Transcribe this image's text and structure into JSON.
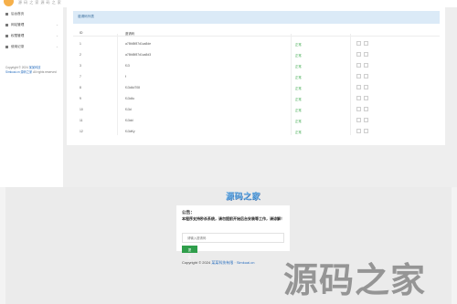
{
  "header": {
    "site_name": "源 码 之 家 源 码 之 家"
  },
  "sidebar": {
    "items": [
      {
        "label": "后台首页",
        "icon": "home-icon"
      },
      {
        "label": "网站管理",
        "icon": "gear-icon"
      },
      {
        "label": "权限管理",
        "icon": "key-icon"
      },
      {
        "label": "使用记录",
        "icon": "list-icon"
      }
    ],
    "footer_text": "Copyright © 2024",
    "footer_link1": "某某科技",
    "footer_link2": "Simkuai.cn 源码之家",
    "footer_rights": "All rights reserved"
  },
  "table": {
    "header_label": "邀请码列表",
    "columns": [
      "ID",
      "邀请码",
      "",
      ""
    ],
    "status_label": "正常",
    "rows": [
      {
        "id": "1",
        "code": "a78fd5f87d1ca8de"
      },
      {
        "id": "2",
        "code": "a78fd5f87d1ca8d3"
      },
      {
        "id": "3",
        "code": "f13"
      },
      {
        "id": "7",
        "code": "f"
      },
      {
        "id": "8",
        "code": "f13d4d708"
      },
      {
        "id": "9",
        "code": "f13d4c"
      },
      {
        "id": "10",
        "code": "f13d"
      },
      {
        "id": "11",
        "code": "f13dd"
      },
      {
        "id": "12",
        "code": "f13dKy"
      }
    ]
  },
  "login": {
    "brand": "源码之家",
    "title": "公告：",
    "message": "本程序支持秒杀系统，请勿提前开始后台安装等工作，请谅解！",
    "input_placeholder": "请输入邀请码",
    "submit_label": "提交",
    "copyright_prefix": "Copyright © 2024",
    "copyright_link": "某某科技有限 · Simkuai.cn"
  },
  "watermark": "源码之家",
  "colors": {
    "accent": "#2f9e4b",
    "status": "#3aa84a",
    "header_bg": "#dbeaf7",
    "link": "#2a6fbf"
  }
}
